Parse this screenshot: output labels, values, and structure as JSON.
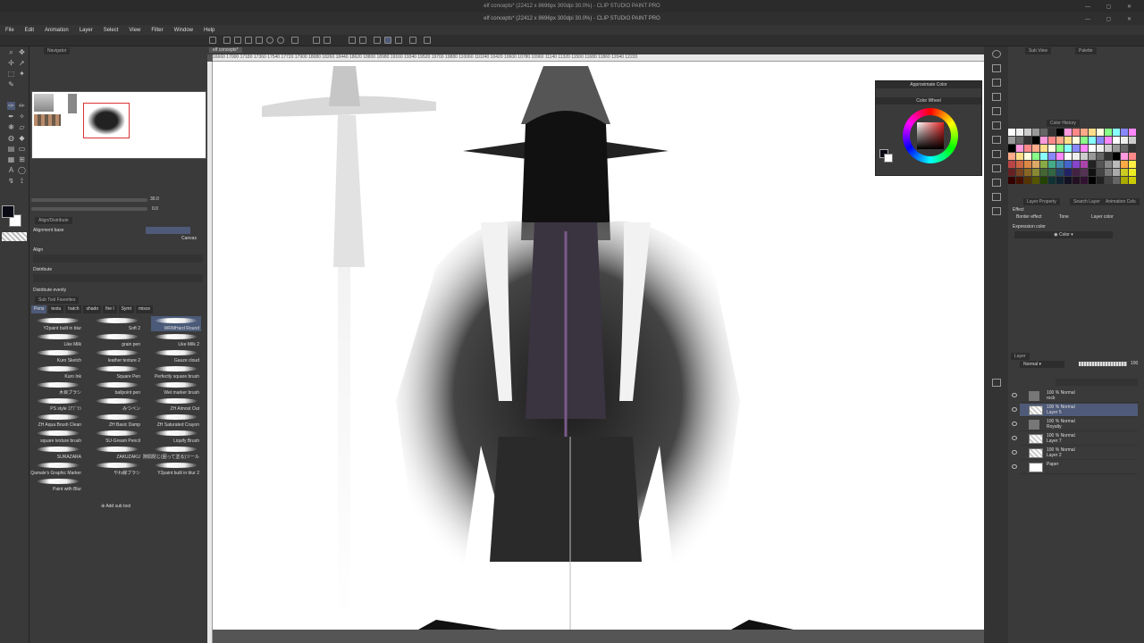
{
  "window": {
    "outer_title": "elf concepts* (22412 x 8696px 300dpi 30.0%) - CLIP STUDIO PAINT PRO",
    "inner_title": "elf concepts* (22412 x 8696px 300dpi 30.0%) - CLIP STUDIO PAINT PRO"
  },
  "menu": [
    "File",
    "Edit",
    "Animation",
    "Layer",
    "Select",
    "View",
    "Filter",
    "Window",
    "Help"
  ],
  "doc_tab": "elf concepts*",
  "ruler_text": "16660 17000 17180 17360 17540 17720 17900 18080 18260 18440 18620 18800 18980 19160 19340 19520 19700 19880 110060 110240 10420 10600 10780 10960 11140 11320 11500 11680 11860 12040 12220",
  "navigator": {
    "tab": "Navigator"
  },
  "zoom_readout": "30.0",
  "rotate_readout": "0.0",
  "align": {
    "tab": "Align/Distribute",
    "base_label": "Alignment base",
    "canvas_label": "Canvas",
    "align_label": "Align",
    "distribute_label": "Distribute",
    "distribute_evenly_label": "Distribute evenly"
  },
  "subtool": {
    "tab": "Sub Tool Favorites",
    "tabs": [
      "Pens",
      "textu",
      "hatch",
      "shado",
      "fire l",
      "Symt",
      "misce"
    ],
    "brushes": [
      "Y2paint built in blur",
      "Soft 2",
      "WRMHard Round",
      "Like Milk",
      "grain pen",
      "Like Milk 2",
      "Kuro Sketch",
      "leather texture 2",
      "Gauze cloud",
      "Kuro Ink",
      "Square Pen",
      "Perfectly square brush",
      "木目ブラシ",
      "ballpoint pen",
      "Wet marker brush",
      "PS style ｴｱﾌﾞﾗｼ",
      "みつペン",
      "ZH Almost Out",
      "ZH Aqua Brush Clean",
      "ZH Basic Damp",
      "ZH Saturated Crayon",
      "square texture brush",
      "SU-Gream Pencil",
      "Liquify Brush",
      "SURAZARA",
      "ZAKUZAKU",
      "隙間閉じ(囲って塗る)ツール",
      "Qamale's Graphic Marker",
      "やわ線ブラシ",
      "Y2paint built in blur 2",
      "Paint with Blur"
    ],
    "add_label": "Add sub tool"
  },
  "approx_color": {
    "title": "Approximate Color",
    "wheel_tab": "Color Wheel"
  },
  "right_tabs": {
    "sub_view": "Sub View",
    "palette": "Palette",
    "color_history": "Color History"
  },
  "layer_property": {
    "tab": "Layer Property",
    "tab2": "Search Layer",
    "tab3": "Animation Cels",
    "effect_label": "Effect",
    "border_label": "Border effect",
    "tone_label": "Tone",
    "layer_color_label": "Layer color",
    "expression_label": "Expression color",
    "expression_value": "Color"
  },
  "layer_panel": {
    "tab": "Layer",
    "blend": "Normal",
    "opacity": "100",
    "layers": [
      {
        "line1": "100 % Normal",
        "line2": "rock",
        "kind": "folder"
      },
      {
        "line1": "100 % Normal",
        "line2": "Layer 5",
        "kind": "raster"
      },
      {
        "line1": "100 % Normal",
        "line2": "Royalty",
        "kind": "folder"
      },
      {
        "line1": "100 % Normal",
        "line2": "Layer 7",
        "kind": "raster"
      },
      {
        "line1": "100 % Normal",
        "line2": "Layer 2",
        "kind": "raster"
      },
      {
        "line1": "",
        "line2": "Paper",
        "kind": "paper"
      }
    ]
  },
  "colors": {
    "accent": "#4e5a78",
    "chrome": "#3a3a3a",
    "canvas": "#ffffff",
    "fg_color": "#0a0a14",
    "bg_color": "#ffffff"
  }
}
